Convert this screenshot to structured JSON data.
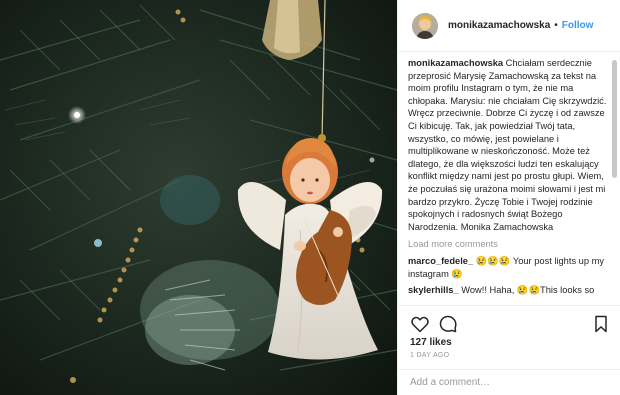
{
  "post": {
    "username": "monikazamachowska",
    "separator": "•",
    "follow_label": "Follow"
  },
  "caption": {
    "username": "monikazamachowska",
    "text": "Chciałam serdecznie przeprosić Marysię Zamachowską za tekst na moim profilu Instagram o tym, że nie ma chłopaka. Marysiu: nie chciałam Cię skrzywdzić. Wręcz przeciwnie. Dobrze Ci życzę i od zawsze Ci kibicuję. Tak, jak powiedział Twój tata, wszystko, co mówię, jest powielane i multiplikowane w nieskończoność. Może też dlatego, że dla większości ludzi ten eskalujący konflikt między nami jest po prostu głupi. Wiem, że poczułaś się urażona moimi słowami i jest mi bardzo przykro. Życzę Tobie i Twojej rodzinie spokojnych i radosnych świąt Bożego Narodzenia. Monika Zamachowska"
  },
  "load_more_label": "Load more comments",
  "comments": [
    {
      "username": "marco_fedele_",
      "text": "😢😢😢 Your post lights up my instagram 😢"
    },
    {
      "username": "skylerhills_",
      "text": "Wow!! Haha, 😢😢This looks so"
    }
  ],
  "likes": "127 likes",
  "time_ago": "1 DAY AGO",
  "add_comment_placeholder": "Add a comment…",
  "icons": {
    "like": "heart-icon",
    "comment": "comment-bubble-icon",
    "save": "bookmark-icon"
  },
  "colors": {
    "follow": "#3897f0",
    "muted": "#999999",
    "text": "#262626"
  }
}
